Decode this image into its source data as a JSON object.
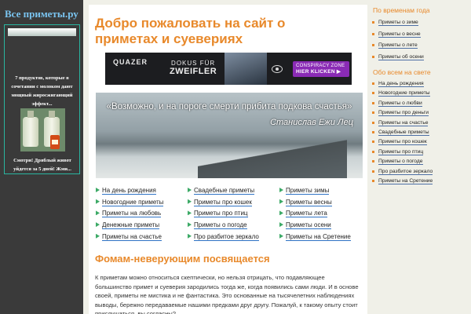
{
  "site_title": "Все приметы.ру",
  "promo": {
    "text1": "7 продуктов, которые в сочетании с молоком дают мощный жиросжигающий эффект...",
    "text2": "Смотри! Дряблый живот уйдется за 5 дней! Жми..."
  },
  "main": {
    "title": "Добро пожаловать на сайт о приметах и суевериях",
    "ad": {
      "logo": "QUAZER",
      "doku_line1": "DOKUS FÜR",
      "doku_line2": "ZWEIFLER",
      "btn_line1": "CONSPIRACY ZONE",
      "btn_line2": "HIER KLICKEN ▶"
    },
    "banner": {
      "quote": "«Возможно, и на пороге смерти прибита подкова счастья»",
      "author": "Станислав Ежи Лец"
    },
    "links": [
      [
        "На день рождения",
        "Свадебные приметы",
        "Приметы зимы"
      ],
      [
        "Новогодние приметы",
        "Приметы про кошек",
        "Приметы весны"
      ],
      [
        "Приметы на любовь",
        "Приметы про птиц",
        "Приметы лета"
      ],
      [
        "Денежные приметы",
        "Приметы о погоде",
        "Приметы осени"
      ],
      [
        "Приметы на счастье",
        "Про разбитое зеркало",
        "Приметы на Сретение"
      ]
    ],
    "subtitle": "Фомам-неверующим посвящается",
    "paragraph": "К приметам можно относиться скептически, но нельзя отрицать, что подавляющее большинство примет и суеверия зародились тогда же, когда появились сами люди. И в основе своей, приметы не мистика и не фантастика. Это основанные на тысячелетних наблюдениях выводы, бережно передаваемые нашими предками друг другу. Пожалуй, к такому опыту стоит прислушаться, вы согласны?"
  },
  "right": {
    "seasons_title": "По временам года",
    "seasons": [
      "Приметы о зиме",
      "Приметы о весне",
      "Приметы о лете",
      "Приметы об осени"
    ],
    "world_title": "Обо всем на свете",
    "world": [
      "На день рождения",
      "Новогодние приметы",
      "Приметы о любви",
      "Приметы про деньги",
      "Приметы на счастье",
      "Свадебные приметы",
      "Приметы про кошек",
      "Приметы про птиц",
      "Приметы о погоде",
      "Про разбитое зеркало",
      "Приметы на Сретение"
    ]
  }
}
